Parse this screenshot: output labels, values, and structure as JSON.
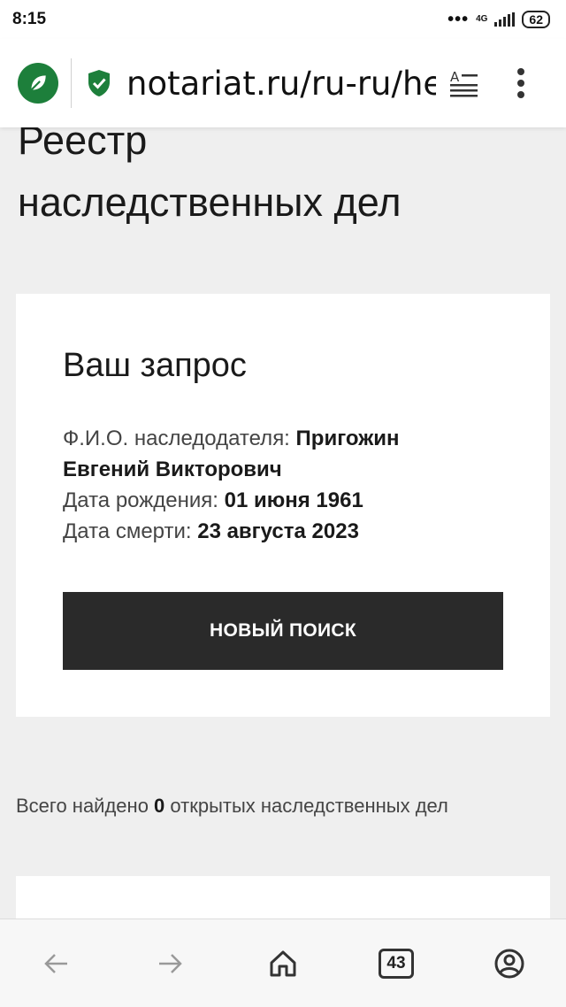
{
  "status_bar": {
    "time": "8:15",
    "network": "4G",
    "battery": "62"
  },
  "browser": {
    "url": "notariat.ru/ru-ru/he",
    "tab_count": "43"
  },
  "page": {
    "title_line1": "Реестр",
    "title_line2": "наследственных дел"
  },
  "request": {
    "heading": "Ваш запрос",
    "name_label": "Ф.И.О. наследодателя: ",
    "name_value": "Пригожин Евгений Викторович",
    "birth_label": "Дата рождения: ",
    "birth_value": "01 июня 1961",
    "death_label": "Дата смерти: ",
    "death_value": "23 августа 2023",
    "new_search_label": "НОВЫЙ ПОИСК"
  },
  "results": {
    "prefix": "Всего найдено ",
    "count": "0",
    "suffix": " открытых наследственных дел"
  },
  "colors": {
    "accent_green": "#1d7f3b",
    "button_dark": "#2a2a2a",
    "page_bg": "#efefef"
  },
  "icons": [
    "leaf-icon",
    "shield-check-icon",
    "reader-mode-icon",
    "more-vert-icon",
    "back-arrow-icon",
    "forward-arrow-icon",
    "home-icon",
    "tabs-icon",
    "profile-icon"
  ]
}
